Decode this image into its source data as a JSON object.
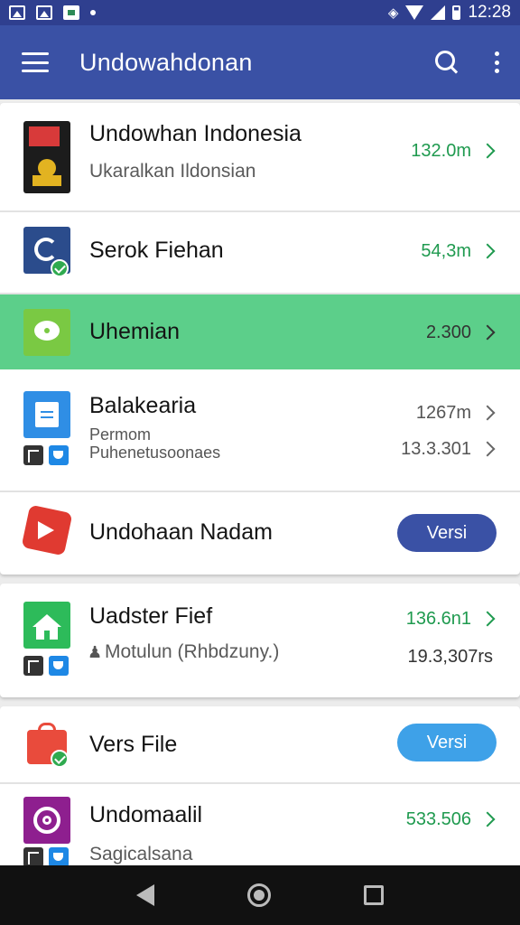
{
  "status_bar": {
    "time": "12:28",
    "icons": [
      "image-icon",
      "image-icon",
      "map-icon",
      "notification-dot",
      "vibrate-icon",
      "wifi-icon",
      "signal-icon",
      "battery-icon"
    ]
  },
  "app_bar": {
    "title": "Undowahdonan",
    "color": "#3a51a5"
  },
  "items": [
    {
      "title": "Undowhan Indonesia",
      "subtitle": "Ukaralkan Ildonsian",
      "value": "132.0m"
    },
    {
      "title": "Serok Fiehan",
      "value": "54,3m"
    },
    {
      "title": "Uhemian",
      "value": "2.300",
      "highlight_color": "#5ccf8a"
    },
    {
      "title": "Balakearia",
      "subtitle_line1": "Permom",
      "subtitle_line2": "Puhenetusoonaes",
      "value1": "1267m",
      "value2": "13.3.301"
    },
    {
      "title": "Undohaan Nadam",
      "button": "Versi",
      "button_color": "#3a51a5"
    },
    {
      "title": "Uadster Fief",
      "subtitle": "Motulun (Rhbdzuny.)",
      "value1": "136.6n1",
      "value2": "19.3,307rs"
    },
    {
      "title": "Vers File",
      "button": "Versi",
      "button_color": "#3ea1e8"
    },
    {
      "title": "Undomaalil",
      "subtitle": "Sagicalsana",
      "value": "533.506"
    }
  ],
  "colors": {
    "value_green": "#1f9a4f",
    "divider": "#e2e2e2"
  }
}
